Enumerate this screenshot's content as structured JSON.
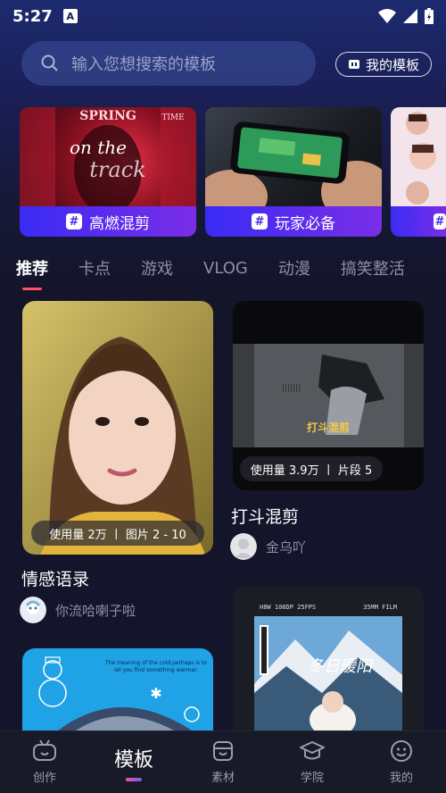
{
  "status": {
    "time": "5:27",
    "notif_icon": "A"
  },
  "search": {
    "placeholder": "输入您想搜索的模板"
  },
  "header": {
    "my_templates_label": "我的模板"
  },
  "banners": [
    {
      "label": "高燃混剪",
      "overlay_lines": [
        "SPRING",
        "on the",
        "track",
        "TIME"
      ]
    },
    {
      "label": "玩家必备"
    },
    {
      "label": ""
    }
  ],
  "tabs": [
    "推荐",
    "卡点",
    "游戏",
    "VLOG",
    "动漫",
    "搞笑整活"
  ],
  "active_tab": "推荐",
  "cards": [
    {
      "title": "情感语录",
      "stats": "使用量 2万 丨 图片 2 - 10",
      "author": "你流哈喇子啦"
    },
    {
      "title": "打斗混剪",
      "stats": "使用量 3.9万 丨 片段 5",
      "author": "金乌吖",
      "thumb_text": "打斗混剪"
    },
    {
      "title": "",
      "snow_text": "The meaning of the cold,perhaps is to let you find something warmer."
    },
    {
      "title": "",
      "film_header": "H8W  108DP 25FPS",
      "film_header2": "35MM FILM",
      "thumb_text": "冬日暖阳"
    }
  ],
  "nav": [
    {
      "label": "创作",
      "icon": "create-icon"
    },
    {
      "label": "模板",
      "icon": "template-icon"
    },
    {
      "label": "素材",
      "icon": "material-icon"
    },
    {
      "label": "学院",
      "icon": "academy-icon"
    },
    {
      "label": "我的",
      "icon": "profile-icon"
    }
  ],
  "colors": {
    "accent": "#ff4d6d",
    "banner_label": "#3a2cf5"
  }
}
